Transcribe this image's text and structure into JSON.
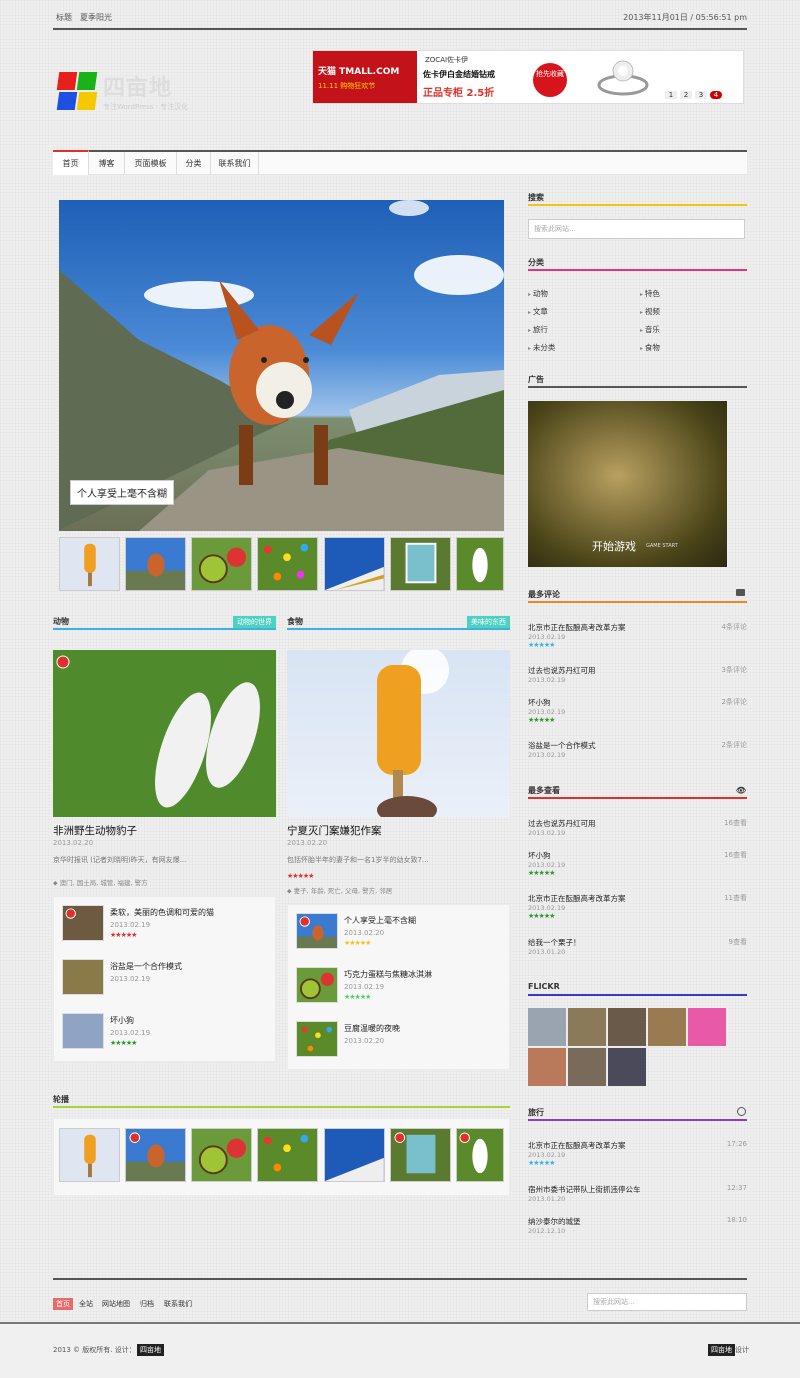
{
  "topbar": {
    "label1": "标题",
    "label2": "夏季阳光",
    "datetime": "2013年11月01日 / 05:56:51 pm"
  },
  "logo": {
    "name": "四亩地",
    "tagline": "专注WordPress · 专注汉化"
  },
  "banner": {
    "brand": "天猫 TMALL.COM",
    "zocai": "ZOCAI佐卡伊",
    "promo": "佐卡伊白金结婚钻戒",
    "sale": "正品专柜 2.5折",
    "grab": "抢先收藏",
    "event": "11.11 购物狂欢节",
    "pages": [
      "1",
      "2",
      "3",
      "4"
    ]
  },
  "nav": {
    "items": [
      "首页",
      "博客",
      "页面模板",
      "分类",
      "联系我们"
    ]
  },
  "hero": {
    "caption": "个人享受上毫不含糊"
  },
  "section_animal": {
    "title": "动物",
    "badge": "动物的世界",
    "post_title": "非洲野生动物豹子",
    "post_date": "2013.02.20",
    "excerpt": "京华时报讯 (记者刘晓明)昨天，有网友爆...",
    "tags": "⬥ 澳门, 国土局, 城管, 福建, 警方",
    "list": [
      {
        "title": "柔软，美丽的色调和可爱的猫",
        "date": "2013.02.19",
        "stars": "★★★★★"
      },
      {
        "title": "浴盐是一个合作模式",
        "date": "2013.02.19",
        "stars": ""
      },
      {
        "title": "坏小狗",
        "date": "2013.02.19",
        "stars": "★★★★★"
      }
    ]
  },
  "section_food": {
    "title": "食物",
    "badge": "美味的东西",
    "post_title": "宁夏灭门案嫌犯作案",
    "post_date": "2013.02.20",
    "excerpt": "包括怀胎半年的妻子和一名1岁半的幼女致7...",
    "stars": "★★★★★",
    "tags": "⬥ 妻子, 年龄, 死亡, 父母, 警方, 邻居",
    "list": [
      {
        "title": "个人享受上毫不含糊",
        "date": "2013.02.20",
        "stars": "★★★★★"
      },
      {
        "title": "巧克力蛋糕与焦糖冰淇淋",
        "date": "2013.02.19",
        "stars": "★★★★★"
      },
      {
        "title": "豆腐温暖的夜晚",
        "date": "2013.02.20",
        "stars": ""
      }
    ]
  },
  "carousel": {
    "title": "轮播"
  },
  "sidebar": {
    "search_title": "搜索",
    "search_placeholder": "搜索此网站...",
    "cat_title": "分类",
    "categories": [
      "动物",
      "特色",
      "文章",
      "视频",
      "旅行",
      "音乐",
      "未分类",
      "食物"
    ],
    "ad_title": "广告",
    "ad_text": "开始游戏",
    "ad_sub": "GAME START",
    "comments_title": "最多评论",
    "comments": [
      {
        "title": "北京市正在酝酿高考改革方案",
        "count": "4条评论",
        "date": "2013.02.19",
        "stars": "★★★★★"
      },
      {
        "title": "过去也说苏丹红可用",
        "count": "3条评论",
        "date": "2013.02.19",
        "stars": ""
      },
      {
        "title": "坏小狗",
        "count": "2条评论",
        "date": "2013.02.19",
        "stars": "★★★★★"
      },
      {
        "title": "浴盐是一个合作模式",
        "count": "2条评论",
        "date": "2013.02.19",
        "stars": ""
      }
    ],
    "views_title": "最多查看",
    "views": [
      {
        "title": "过去也说苏丹红可用",
        "count": "16查看",
        "date": "2013.02.19",
        "stars": ""
      },
      {
        "title": "坏小狗",
        "count": "16查看",
        "date": "2013.02.19",
        "stars": "★★★★★"
      },
      {
        "title": "北京市正在酝酿高考改革方案",
        "count": "11查看",
        "date": "2013.02.19",
        "stars": "★★★★★"
      },
      {
        "title": "给我一个栗子！",
        "count": "9查看",
        "date": "2013.01.20",
        "stars": ""
      }
    ],
    "flickr_title": "FLICKR",
    "travel_title": "旅行",
    "travel": [
      {
        "title": "北京市正在酝酿高考改革方案",
        "time": "17:26",
        "date": "2013.02.19",
        "stars": "★★★★★"
      },
      {
        "title": "宿州市委书记带队上街抓违停公车",
        "time": "12:37",
        "date": "2013.01.20",
        "stars": ""
      },
      {
        "title": "纳沙泰尔的城堡",
        "time": "18:10",
        "date": "2012.12.10",
        "stars": ""
      }
    ]
  },
  "footer": {
    "links": [
      "首页",
      "全站",
      "网站地图",
      "归档",
      "联系我们"
    ],
    "search_placeholder": "搜索此网站...",
    "copyright": "2013 © 版权所有. 设计：",
    "brand": "四亩地",
    "brand2": "四亩地",
    "design": "设计"
  },
  "colors": {
    "accent": "#e0302a",
    "blue": "#3bb3e0",
    "pink": "#e8317e",
    "yellow": "#f0c419",
    "teal": "#4cd1c2",
    "green": "#a4d63a",
    "purple": "#8e3bc7",
    "red": "#e0302a"
  }
}
